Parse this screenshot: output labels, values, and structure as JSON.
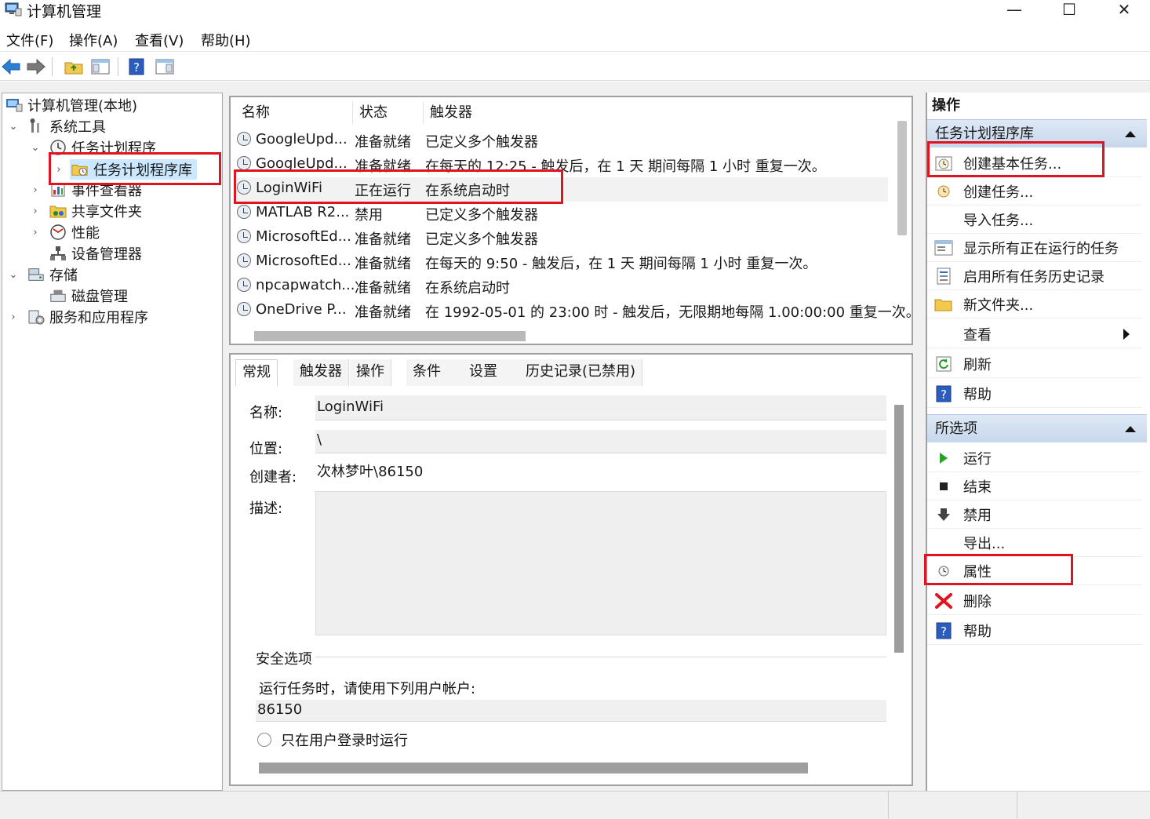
{
  "window": {
    "title": "计算机管理",
    "minimize_glyph": "—",
    "maximize_glyph": "☐",
    "close_glyph": "✕"
  },
  "menu": [
    "文件(F)",
    "操作(A)",
    "查看(V)",
    "帮助(H)"
  ],
  "tree": {
    "root": "计算机管理(本地)",
    "system_tools": "系统工具",
    "task_scheduler": "任务计划程序",
    "task_library": "任务计划程序库",
    "event_viewer": "事件查看器",
    "shared_folders": "共享文件夹",
    "performance": "性能",
    "device_manager": "设备管理器",
    "storage": "存储",
    "disk_management": "磁盘管理",
    "services_apps": "服务和应用程序"
  },
  "list": {
    "headers": [
      "名称",
      "状态",
      "触发器"
    ],
    "rows": [
      {
        "name": "GoogleUpd...",
        "status": "准备就绪",
        "trigger": "已定义多个触发器"
      },
      {
        "name": "GoogleUpd...",
        "status": "准备就绪",
        "trigger": "在每天的 12:25 - 触发后，在 1 天 期间每隔 1 小时 重复一次。"
      },
      {
        "name": "LoginWiFi",
        "status": "正在运行",
        "trigger": "在系统启动时"
      },
      {
        "name": "MATLAB R2...",
        "status": "禁用",
        "trigger": "已定义多个触发器"
      },
      {
        "name": "MicrosoftEd...",
        "status": "准备就绪",
        "trigger": "已定义多个触发器"
      },
      {
        "name": "MicrosoftEd...",
        "status": "准备就绪",
        "trigger": "在每天的 9:50 - 触发后，在 1 天 期间每隔 1 小时 重复一次。"
      },
      {
        "name": "npcapwatch...",
        "status": "准备就绪",
        "trigger": "在系统启动时"
      },
      {
        "name": "OneDrive P...",
        "status": "准备就绪",
        "trigger": "在 1992-05-01 的 23:00 时 - 触发后，无限期地每隔 1.00:00:00 重复一次。"
      }
    ]
  },
  "detail": {
    "tabs": [
      "常规",
      "触发器",
      "操作",
      "条件",
      "设置",
      "历史记录(已禁用)"
    ],
    "name_label": "名称:",
    "name_value": "LoginWiFi",
    "location_label": "位置:",
    "location_value": "\\",
    "author_label": "创建者:",
    "author_value": "次林梦叶\\86150",
    "desc_label": "描述:",
    "security_title": "安全选项",
    "run_as_label": "运行任务时，请使用下列用户帐户:",
    "run_as_value": "86150",
    "radio_label": "只在用户登录时运行"
  },
  "actions": {
    "title": "操作",
    "section1": "任务计划程序库",
    "section1_items": [
      "创建基本任务...",
      "创建任务...",
      "导入任务...",
      "显示所有正在运行的任务",
      "启用所有任务历史记录",
      "新文件夹...",
      "查看",
      "刷新",
      "帮助"
    ],
    "section2": "所选项",
    "section2_items": [
      "运行",
      "结束",
      "禁用",
      "导出...",
      "属性",
      "删除",
      "帮助"
    ]
  },
  "colors": {
    "highlight": "#e0141e",
    "selection": "#cce8ff",
    "header_gradient": "#c6d7ec"
  }
}
